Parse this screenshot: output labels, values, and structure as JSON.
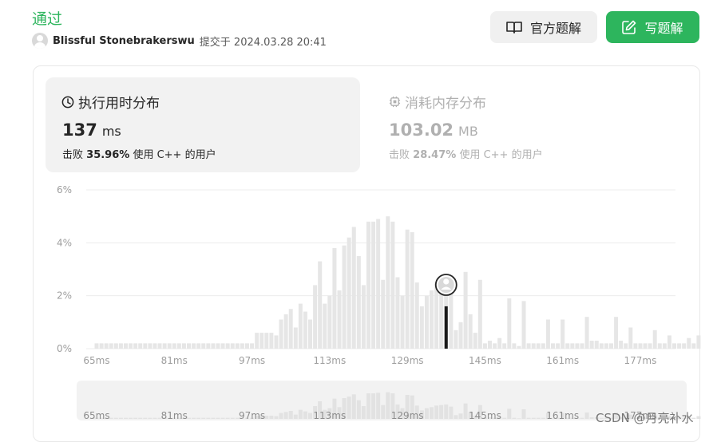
{
  "header": {
    "status": "通过",
    "username": "Blissful Stonebrakerswu",
    "submitted_text": "提交于 2024.03.28 20:41",
    "official_solution_label": "官方题解",
    "write_solution_label": "写题解"
  },
  "runtime": {
    "title": "执行用时分布",
    "value": "137",
    "unit": "ms",
    "beats_prefix": "击败",
    "beats_percent": "35.96%",
    "beats_suffix": "使用 C++ 的用户"
  },
  "memory": {
    "title": "消耗内存分布",
    "value": "103.02",
    "unit": "MB",
    "beats_prefix": "击败",
    "beats_percent": "28.47%",
    "beats_suffix": "使用 C++ 的用户"
  },
  "watermark": "CSDN @月亮补水",
  "colors": {
    "accent": "#2db55d",
    "bar": "#e6e6e6",
    "marker": "#1a1a1a"
  },
  "chart_data": {
    "type": "bar",
    "x_ticks": [
      "65ms",
      "81ms",
      "97ms",
      "113ms",
      "129ms",
      "145ms",
      "161ms",
      "177ms"
    ],
    "y_ticks": [
      "0%",
      "2%",
      "4%",
      "6%"
    ],
    "ylim": [
      0,
      6
    ],
    "x_range": [
      65,
      189
    ],
    "highlight_x": 137,
    "highlight_value": 1.6,
    "series": [
      {
        "x": [
          65,
          66,
          67,
          68,
          69,
          70,
          71,
          72,
          73,
          74,
          75,
          76,
          77,
          78,
          79,
          80,
          81,
          82,
          83,
          84,
          85,
          86,
          87,
          88,
          89,
          90,
          91,
          92,
          93,
          94,
          95,
          96,
          97,
          98,
          99,
          100,
          101,
          102,
          103,
          104,
          105,
          106,
          107,
          108,
          109,
          110,
          111,
          112,
          113,
          114,
          115,
          116,
          117,
          118,
          119,
          120,
          121,
          122,
          123,
          124,
          125,
          126,
          127,
          128,
          129,
          130,
          131,
          132,
          133,
          134,
          135,
          136,
          137,
          138,
          139,
          140,
          141,
          142,
          143,
          144,
          145,
          146,
          147,
          148,
          149,
          150,
          151,
          152,
          153,
          154,
          155,
          156,
          157,
          158,
          159,
          160,
          161,
          162,
          163,
          164,
          165,
          166,
          167,
          168,
          169,
          170,
          171,
          172,
          173,
          174,
          175,
          176,
          177,
          178,
          179,
          180,
          181,
          182,
          183,
          184,
          185,
          186,
          187,
          188,
          189
        ],
        "values": [
          0.2,
          0.2,
          0.2,
          0.2,
          0.2,
          0.2,
          0.2,
          0.2,
          0.2,
          0.2,
          0.2,
          0.2,
          0.2,
          0.2,
          0.2,
          0.2,
          0.2,
          0.2,
          0.2,
          0.2,
          0.2,
          0.2,
          0.2,
          0.2,
          0.2,
          0.2,
          0.2,
          0.2,
          0.2,
          0.2,
          0.2,
          0.2,
          0.2,
          0.6,
          0.6,
          0.6,
          0.6,
          0.5,
          1.1,
          1.3,
          1.5,
          0.8,
          1.7,
          1.4,
          1.1,
          2.4,
          3.3,
          1.7,
          2.0,
          3.8,
          2.2,
          3.9,
          4.2,
          4.6,
          3.5,
          2.4,
          4.8,
          4.8,
          4.9,
          2.6,
          5.0,
          4.8,
          2.7,
          2.0,
          4.5,
          4.4,
          2.5,
          1.6,
          2.0,
          2.2,
          2.5,
          2.6,
          2.7,
          2.3,
          0.7,
          1.0,
          2.9,
          1.3,
          0.6,
          2.6,
          0.2,
          0.3,
          0.2,
          0.4,
          0.2,
          1.9,
          0.2,
          0.1,
          1.8,
          0.2,
          0.2,
          0.2,
          0.2,
          1.1,
          0.2,
          0.2,
          1.1,
          0.2,
          0.2,
          0.2,
          0.2,
          1.2,
          0.3,
          0.3,
          0.2,
          0.2,
          0.2,
          1.2,
          0.3,
          0.2,
          0.8,
          0.2,
          0.2,
          0.2,
          0.2,
          0.7,
          0.2,
          0.2,
          0.5,
          0.2,
          0.2,
          0.2,
          0.4,
          0.2,
          0.5
        ]
      }
    ]
  }
}
